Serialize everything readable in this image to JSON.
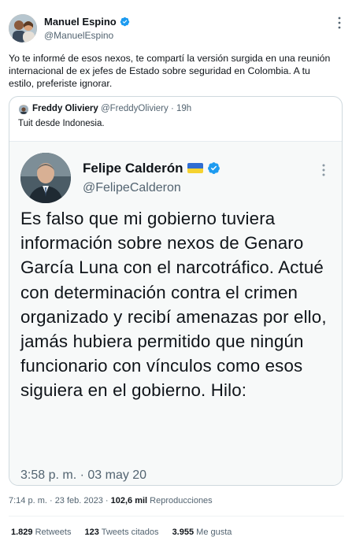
{
  "author": {
    "name": "Manuel Espino",
    "handle": "@ManuelEspino"
  },
  "tweet": {
    "text": "Yo te informé de esos nexos, te compartí la versión surgida en una reunión internacional de ex jefes de Estado sobre seguridad en Colombia. A tu estilo, preferiste ignorar."
  },
  "quote": {
    "name": "Freddy Oliviery",
    "handle": "@FreddyOliviery",
    "separator": "·",
    "time": "19h",
    "text": "Tuit desde Indonesia.",
    "card": {
      "name": "Felipe Calderón",
      "handle": "@FelipeCalderon",
      "body": "Es falso que mi gobierno tuviera información sobre nexos de Genaro García Luna con el narcotráfico. Actué con determinación contra el crimen organizado y recibí amenazas por ello, jamás hubiera permitido que ningún funcionario con vínculos como esos siguiera en el gobierno. Hilo:",
      "timestamp": "3:58 p. m. · 03 may 20"
    }
  },
  "meta": {
    "time": "7:14 p. m. · 23 feb. 2023 · ",
    "views_count": "102,6 mil",
    "views_label": " Reproducciones"
  },
  "stats": {
    "retweets_count": "1.829",
    "retweets_label": " Retweets",
    "quotes_count": "123",
    "quotes_label": " Tweets citados",
    "likes_count": "3.955",
    "likes_label": " Me gusta"
  },
  "colors": {
    "verified": "#1d9bf0",
    "secondary_text": "#536471",
    "border": "#cfd9de"
  },
  "icons": [
    "verified-badge-icon",
    "more-options-icon",
    "ukraine-flag-icon"
  ]
}
